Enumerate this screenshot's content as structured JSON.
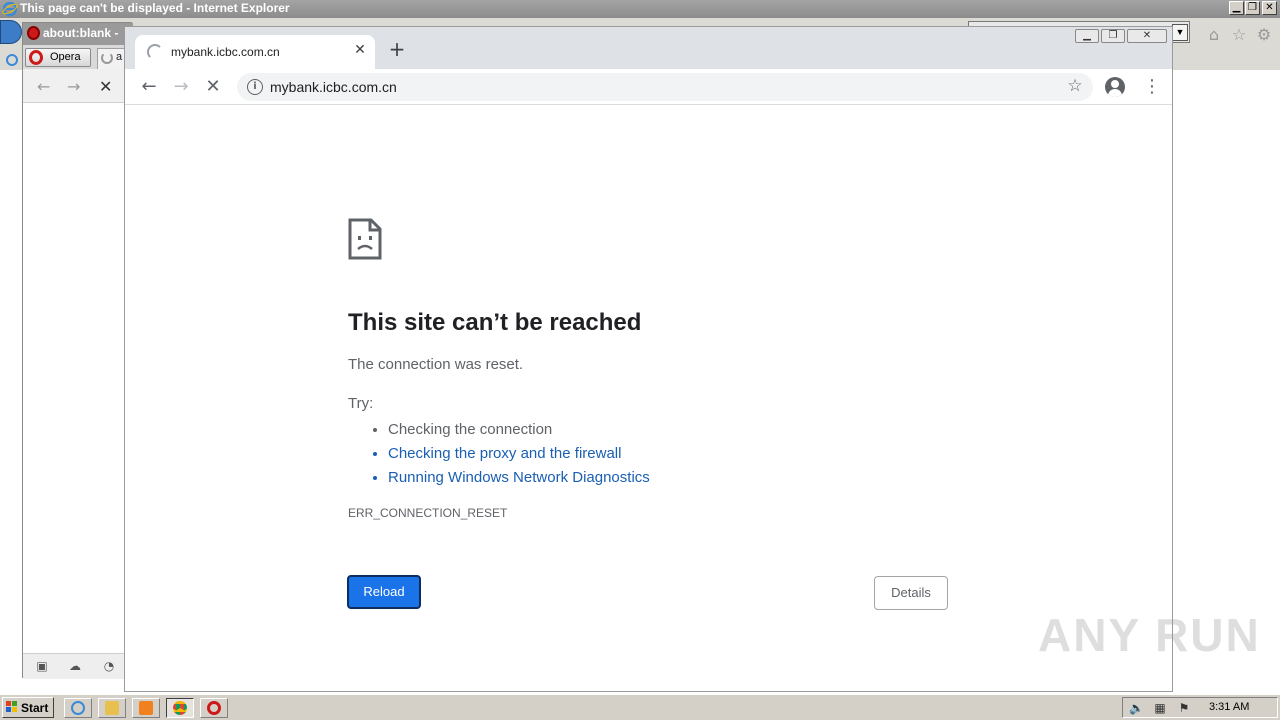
{
  "ie": {
    "title": "This page can't be displayed - Internet Explorer",
    "min_glyph": "▁",
    "max_glyph": "❐",
    "close_glyph": "✕"
  },
  "opera": {
    "title": "about:blank - ",
    "menu_label": "Opera",
    "tab_letter": "a"
  },
  "chrome": {
    "tab_title": "mybank.icbc.com.cn",
    "tab_close_glyph": "✕",
    "new_tab_glyph": "+",
    "url": "mybank.icbc.com.cn",
    "info_glyph": "i",
    "star_glyph": "☆",
    "menu_glyph": "⋮"
  },
  "error": {
    "heading": "This site can’t be reached",
    "message": "The connection was reset.",
    "try_label": "Try:",
    "suggestions": [
      "Checking the connection",
      "Checking the proxy and the firewall",
      "Running Windows Network Diagnostics"
    ],
    "code": "ERR_CONNECTION_RESET",
    "reload_label": "Reload",
    "details_label": "Details"
  },
  "watermark": "ANY RUN",
  "taskbar": {
    "start_label": "Start",
    "clock": "3:31 AM"
  },
  "colors": {
    "link": "#1a5fb4",
    "reload_bg": "#1a73e8",
    "chrome_tabstrip": "#dee1e6"
  }
}
